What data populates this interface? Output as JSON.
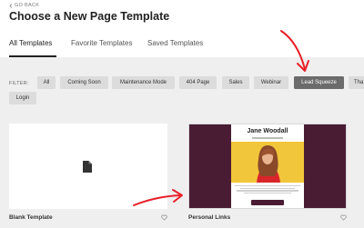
{
  "nav": {
    "go_back": "GO BACK"
  },
  "page": {
    "title": "Choose a New Page Template"
  },
  "tabs": [
    {
      "label": "All Templates",
      "active": true
    },
    {
      "label": "Favorite Templates",
      "active": false
    },
    {
      "label": "Saved Templates",
      "active": false
    }
  ],
  "filter": {
    "label": "FILTER:",
    "buttons": [
      {
        "label": "All",
        "active": false
      },
      {
        "label": "Coming Soon",
        "active": false
      },
      {
        "label": "Maintenance Mode",
        "active": false
      },
      {
        "label": "404 Page",
        "active": false
      },
      {
        "label": "Sales",
        "active": false
      },
      {
        "label": "Webinar",
        "active": false
      },
      {
        "label": "Lead Squeeze",
        "active": true
      },
      {
        "label": "Tha",
        "active": false
      },
      {
        "label": "Login",
        "active": false
      }
    ]
  },
  "templates": [
    {
      "label": "Blank Template",
      "icon": "document-icon"
    },
    {
      "label": "Personal Links",
      "preview_name": "Jane Woodall"
    }
  ],
  "colors": {
    "active_filter": "#6b6b6b",
    "annotation_arrow": "#e8202a",
    "preview_sidebar": "#4a1c33",
    "preview_photo_bg": "#f2c63a"
  }
}
